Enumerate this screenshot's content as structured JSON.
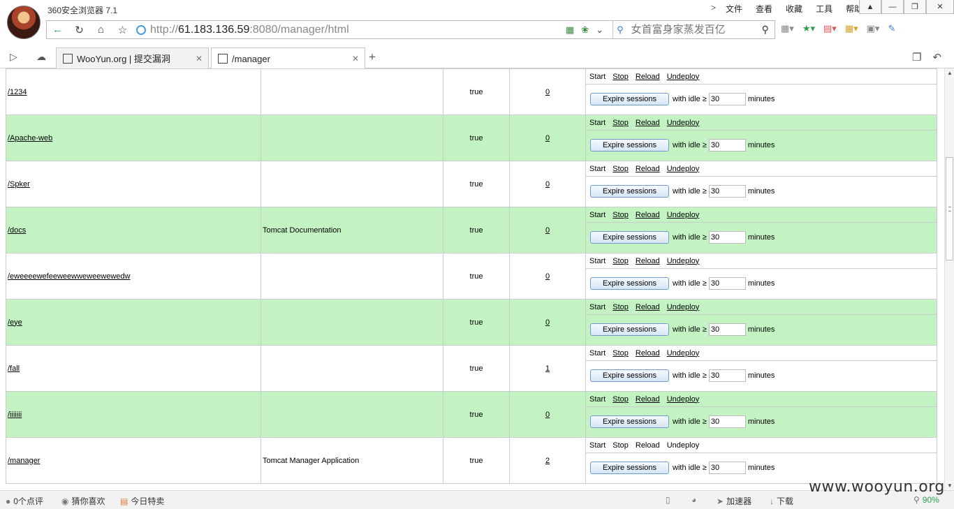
{
  "browser": {
    "app_title": "360安全浏览器 7.1",
    "menus": [
      "文件",
      "查看",
      "收藏",
      "工具",
      "帮助"
    ],
    "address": {
      "scheme": "http://",
      "host": "61.183.136.59",
      "rest": ":8080/manager/html"
    },
    "search_placeholder": "女首富身家蒸发百亿",
    "tabs": [
      {
        "title": "WooYun.org | 提交漏洞",
        "active": false
      },
      {
        "title": "/manager",
        "active": true
      }
    ]
  },
  "commands": {
    "start": "Start",
    "stop": "Stop",
    "reload": "Reload",
    "undeploy": "Undeploy"
  },
  "expire": {
    "button": "Expire sessions",
    "with_idle": "with idle ≥",
    "idle_value": "30",
    "minutes": "minutes"
  },
  "applications": [
    {
      "path": "/1234",
      "display_name": "",
      "running": "true",
      "sessions": "0"
    },
    {
      "path": "/Apache-web",
      "display_name": "",
      "running": "true",
      "sessions": "0"
    },
    {
      "path": "/Spker",
      "display_name": "",
      "running": "true",
      "sessions": "0"
    },
    {
      "path": "/docs",
      "display_name": "Tomcat Documentation",
      "running": "true",
      "sessions": "0"
    },
    {
      "path": "/eweeeewefeeweewweweewewedw",
      "display_name": "",
      "running": "true",
      "sessions": "0"
    },
    {
      "path": "/eye",
      "display_name": "",
      "running": "true",
      "sessions": "0"
    },
    {
      "path": "/fall",
      "display_name": "",
      "running": "true",
      "sessions": "1"
    },
    {
      "path": "/iiiiiii",
      "display_name": "",
      "running": "true",
      "sessions": "0"
    },
    {
      "path": "/manager",
      "display_name": "Tomcat Manager Application",
      "running": "true",
      "sessions": "2"
    }
  ],
  "statusbar": {
    "comments": "0个点评",
    "guess": "猜你喜欢",
    "deals": "今日特卖",
    "accelerator": "加速器",
    "download": "下载",
    "zoom": "90%"
  },
  "watermark": "www.wooyun.org",
  "colors": {
    "row_highlight": "#c3f3c3",
    "accent_green": "#2aa24a"
  }
}
